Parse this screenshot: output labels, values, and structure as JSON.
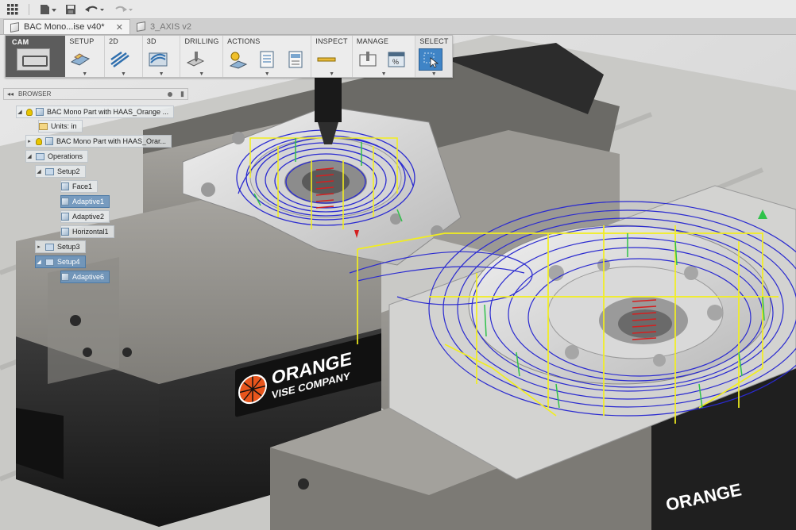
{
  "quick_access": {
    "icons": [
      "grid-icon",
      "file-icon",
      "save-icon",
      "undo-icon",
      "redo-icon"
    ]
  },
  "tabs": [
    {
      "label": "BAC Mono...ise v40*",
      "active": true
    },
    {
      "label": "3_AXIS v2",
      "active": false
    }
  ],
  "ribbon": {
    "workspace": "CAM",
    "groups": [
      {
        "label": "SETUP"
      },
      {
        "label": "2D"
      },
      {
        "label": "3D"
      },
      {
        "label": "DRILLING"
      },
      {
        "label": "ACTIONS"
      },
      {
        "label": "INSPECT"
      },
      {
        "label": "MANAGE"
      },
      {
        "label": "SELECT"
      }
    ]
  },
  "browser": {
    "title": "BROWSER",
    "nodes": [
      {
        "label": "BAC Mono Part with HAAS_Orange ..."
      },
      {
        "label": "Units: in"
      },
      {
        "label": "BAC Mono Part with HAAS_Orar..."
      },
      {
        "label": "Operations"
      },
      {
        "label": "Setup2"
      },
      {
        "label": "Face1"
      },
      {
        "label": "Adaptive1"
      },
      {
        "label": "Adaptive2"
      },
      {
        "label": "Horizontal1"
      },
      {
        "label": "Setup3"
      },
      {
        "label": "Setup4"
      },
      {
        "label": "Adaptive6"
      }
    ]
  },
  "scene": {
    "logo_line1": "ORANGE",
    "logo_line2": "VISE COMPANY",
    "logo_line3": "ORANGE"
  },
  "colors": {
    "toolpath_blue": "#2a2ad0",
    "toolpath_yellow": "#f2ee1e",
    "toolpath_green": "#2fc24a",
    "toolpath_red": "#d42020",
    "vise_dark": "#2a2a2a",
    "vise_gray": "#8f8d88",
    "logo_orange": "#e8551c"
  }
}
